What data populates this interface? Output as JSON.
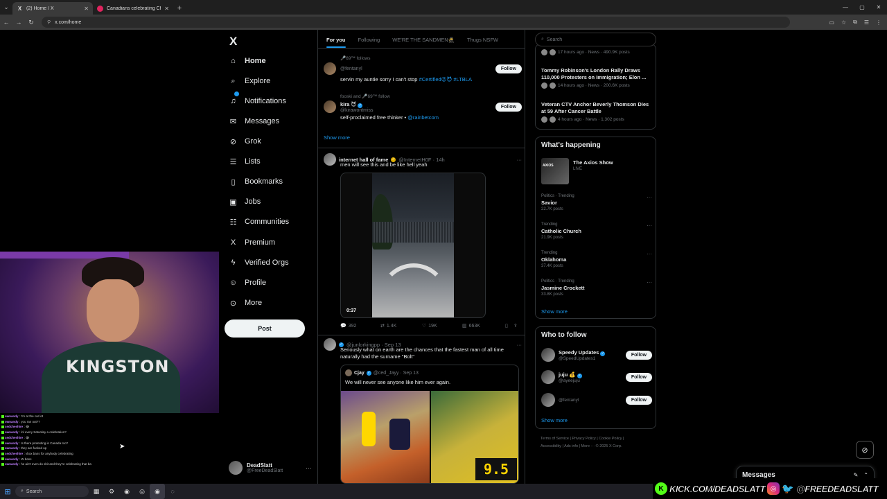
{
  "browser": {
    "tabs": [
      {
        "label": "(2) Home / X",
        "favicon": "X",
        "active": true
      },
      {
        "label": "Canadians celebrating Charlie K",
        "favicon": "pink",
        "active": false
      }
    ],
    "url": "x.com/home"
  },
  "sidebar": {
    "logo": "X",
    "items": [
      {
        "label": "Home",
        "icon": "home-icon",
        "glyph": "⌂"
      },
      {
        "label": "Explore",
        "icon": "search-icon",
        "glyph": "⌕"
      },
      {
        "label": "Notifications",
        "icon": "bell-icon",
        "glyph": "♫"
      },
      {
        "label": "Messages",
        "icon": "envelope-icon",
        "glyph": "✉"
      },
      {
        "label": "Grok",
        "icon": "grok-icon",
        "glyph": "⊘"
      },
      {
        "label": "Lists",
        "icon": "list-icon",
        "glyph": "☰"
      },
      {
        "label": "Bookmarks",
        "icon": "bookmark-icon",
        "glyph": "▯"
      },
      {
        "label": "Jobs",
        "icon": "briefcase-icon",
        "glyph": "▣"
      },
      {
        "label": "Communities",
        "icon": "people-icon",
        "glyph": "☷"
      },
      {
        "label": "Premium",
        "icon": "x-icon",
        "glyph": "X"
      },
      {
        "label": "Verified Orgs",
        "icon": "lightning-icon",
        "glyph": "ϟ"
      },
      {
        "label": "Profile",
        "icon": "person-icon",
        "glyph": "☺"
      },
      {
        "label": "More",
        "icon": "more-circle-icon",
        "glyph": "⊙"
      }
    ],
    "post_label": "Post",
    "account": {
      "name": "DeadSlatt",
      "handle": "@FreeDeadSlatt",
      "more": "···"
    }
  },
  "feed": {
    "tabs": [
      "For you",
      "Following",
      "WE'RE THE SANDMEN🥷",
      "Thugs NSFW"
    ],
    "suggestions": [
      {
        "context": "🎤69™ follows",
        "name": "",
        "handle": "@fentanyl",
        "bio": "servin my auntie sorry I can't stop",
        "bio_link": "#Certified😜😈 #LTBLA",
        "follow": "Follow"
      },
      {
        "context": "fooski and 🎤69™ follow",
        "name": "kira 😈",
        "handle": "@kirawontmiss",
        "bio": "self-proclaimed free thinker  •",
        "bio_link": "@rainbetcom",
        "follow": "Follow"
      }
    ],
    "show_more": "Show more",
    "tweet1": {
      "name": "internet hall of fame",
      "handle": "@InternetH0F · 14h",
      "text": "men will see this and be like hell yeah",
      "duration": "0:37",
      "replies": "392",
      "reposts": "1.4K",
      "likes": "19K",
      "views": "663K"
    },
    "tweet2": {
      "handle": "@junlorkingpp · Sep 13",
      "text": "Seriously what on earth are the chances that the fastest man of all time naturally had the surname \"Bolt\"",
      "quote": {
        "name": "Cjay",
        "handle": "@ced_Jayy · Sep 13",
        "text": "We will never see anyone like him ever again."
      }
    }
  },
  "right": {
    "search_placeholder": "Search",
    "news": [
      {
        "headline": "",
        "meta": "17 hours ago · News · 490.9K posts"
      },
      {
        "headline": "Tommy Robinson's London Rally Draws 110,000 Protesters on Immigration; Elon ...",
        "meta": "14 hours ago · News · 200.6K posts"
      },
      {
        "headline": "Veteran CTV Anchor Beverly Thomson Dies at 59 After Cancer Battle",
        "meta": "4 hours ago · News · 1,302 posts"
      }
    ],
    "whats_happening": {
      "title": "What's happening",
      "live": {
        "name": "The Axios Show",
        "status": "LIVE",
        "thumb": "AXIOS"
      },
      "trends": [
        {
          "category": "Politics · Trending",
          "name": "Savior",
          "posts": "22.7K posts"
        },
        {
          "category": "Trending",
          "name": "Catholic Church",
          "posts": "21.9K posts"
        },
        {
          "category": "Trending",
          "name": "Oklahoma",
          "posts": "37.4K posts"
        },
        {
          "category": "Politics · Trending",
          "name": "Jasmine Crockett",
          "posts": "33.8K posts"
        }
      ],
      "show_more": "Show more"
    },
    "who_to_follow": {
      "title": "Who to follow",
      "accounts": [
        {
          "name": "Speedy Updates",
          "handle": "@SpeedUpdates1",
          "follow": "Follow"
        },
        {
          "name": "juju 💰",
          "handle": "@ayeejuju",
          "follow": "Follow"
        },
        {
          "name": "",
          "handle": "@fentanyl",
          "follow": "Follow"
        }
      ],
      "show_more": "Show more"
    },
    "footer": [
      "Terms of Service",
      "Privacy Policy",
      "Cookie Policy",
      "Accessibility",
      "Ads info",
      "More ···",
      "© 2025 X Corp."
    ]
  },
  "messages_drawer": {
    "label": "Messages"
  },
  "stream": {
    "jersey": "KINGSTON",
    "chat": [
      {
        "user": "ownandy",
        "msg": "I'm at the car lot"
      },
      {
        "user": "ownandy",
        "msg": "you ran out??"
      },
      {
        "user": "cedcheshire",
        "msg": "😂"
      },
      {
        "user": "ownandy",
        "msg": "lol every Saturday a celebration?"
      },
      {
        "user": "cedcheshire",
        "msg": "😭"
      },
      {
        "user": "ownandy",
        "msg": "Is there protesting in Canada too?"
      },
      {
        "user": "ownandy",
        "msg": "they are fucked up"
      },
      {
        "user": "cedcheshire",
        "msg": "vbox bans for anybody celebrating"
      },
      {
        "user": "ownandy",
        "msg": "W bans"
      },
      {
        "user": "ownandy",
        "msg": "he ain't even do shit and they're celebrating that ba"
      }
    ],
    "banner_kick": "KICK.COM/DEADSLATT",
    "banner_social": "@FREEDEADSLATT"
  },
  "taskbar": {
    "search_placeholder": "Search"
  }
}
